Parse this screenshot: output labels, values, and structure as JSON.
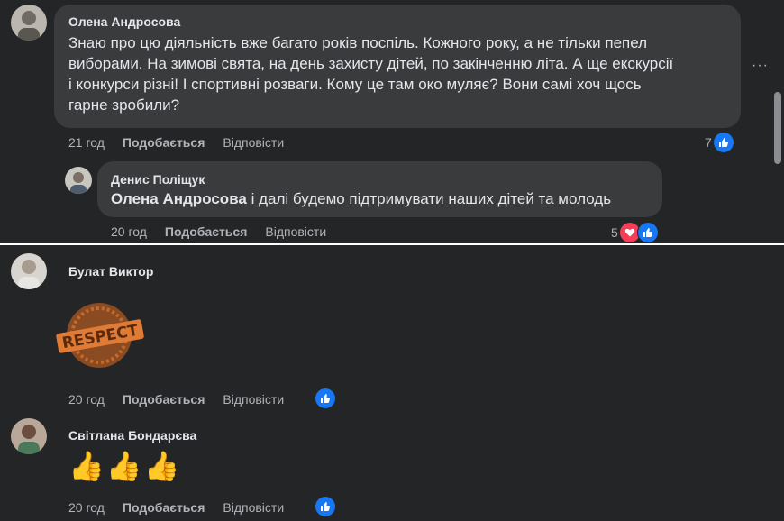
{
  "comment1": {
    "author": "Олена Андросова",
    "lines": [
      "Знаю про цю діяльність вже багато років поспіль. Кожного року, а не тільки пепел",
      "виборами. На зимові свята, на день захисту дітей, по закінченню літа. А ще екскурсії",
      "і конкурси різні! І спортивні розваги. Кому це там око муляє? Вони самі хоч щось",
      "гарне зробили?"
    ],
    "time": "21 год",
    "like_label": "Подобається",
    "reply_label": "Відповісти",
    "reaction_count": "7",
    "more_label": "···"
  },
  "reply1": {
    "author": "Денис Поліщук",
    "mention": "Олена Андросова",
    "text": " і далі будемо підтримувати наших дітей та молодь",
    "time": "20 год",
    "like_label": "Подобається",
    "reply_label": "Відповісти",
    "reaction_count": "5"
  },
  "comment2": {
    "author": "Булат Виктор",
    "sticker_text": "RESPECT",
    "time": "20 год",
    "like_label": "Подобається",
    "reply_label": "Відповісти"
  },
  "comment3": {
    "author": "Світлана Бондарєва",
    "emoji": "👍👍👍",
    "time": "20 год",
    "like_label": "Подобається",
    "reply_label": "Відповісти"
  }
}
